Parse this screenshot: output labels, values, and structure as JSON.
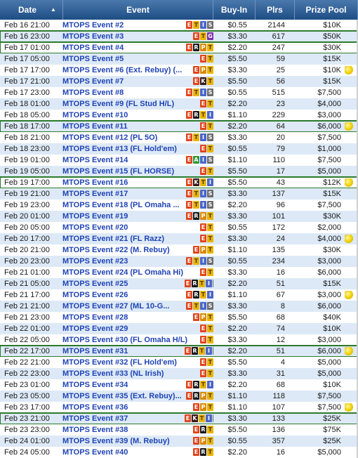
{
  "header": {
    "date_label": "Date",
    "sort_arrow": "▲",
    "event_label": "Event",
    "buyin_label": "Buy-In",
    "plrs_label": "Plrs",
    "prize_label": "Prize Pool"
  },
  "rows": [
    {
      "date": "Feb 16 21:00",
      "name": "MTOPS Event #2",
      "icons": [
        "E",
        "T",
        "I",
        "S"
      ],
      "buyin": "$0.55",
      "plrs": "2144",
      "prize": "$10K",
      "hl": false,
      "star": false
    },
    {
      "date": "Feb 16 23:00",
      "name": "MTOPS Event #3",
      "icons": [
        "E",
        "T",
        "G"
      ],
      "buyin": "$3.30",
      "plrs": "617",
      "prize": "$50K",
      "hl": true,
      "star": false
    },
    {
      "date": "Feb 17 01:00",
      "name": "MTOPS Event #4",
      "icons": [
        "E",
        "R",
        "P",
        "T"
      ],
      "buyin": "$2.20",
      "plrs": "247",
      "prize": "$30K",
      "hl": true,
      "star": false
    },
    {
      "date": "Feb 17 05:00",
      "name": "MTOPS Event #5",
      "icons": [
        "E",
        "T"
      ],
      "buyin": "$5.50",
      "plrs": "59",
      "prize": "$15K",
      "hl": false,
      "star": false
    },
    {
      "date": "Feb 17 17:00",
      "name": "MTOPS Event #6 (Ext. Rebuy) (...",
      "icons": [
        "E",
        "P",
        "T"
      ],
      "buyin": "$3.30",
      "plrs": "25",
      "prize": "$10K",
      "hl": false,
      "star": true
    },
    {
      "date": "Feb 17 21:00",
      "name": "MTOPS Event #7",
      "icons": [
        "E",
        "K",
        "T"
      ],
      "buyin": "$5.50",
      "plrs": "56",
      "prize": "$15K",
      "hl": false,
      "star": false
    },
    {
      "date": "Feb 17 23:00",
      "name": "MTOPS Event #8",
      "icons": [
        "E",
        "T",
        "I",
        "S"
      ],
      "buyin": "$0.55",
      "plrs": "515",
      "prize": "$7,500",
      "hl": false,
      "star": false
    },
    {
      "date": "Feb 18 01:00",
      "name": "MTOPS Event #9 (FL Stud H/L)",
      "icons": [
        "E",
        "T"
      ],
      "buyin": "$2.20",
      "plrs": "23",
      "prize": "$4,000",
      "hl": false,
      "star": false
    },
    {
      "date": "Feb 18 05:00",
      "name": "MTOPS Event #10",
      "icons": [
        "E",
        "R",
        "T",
        "I"
      ],
      "buyin": "$1.10",
      "plrs": "229",
      "prize": "$3,000",
      "hl": false,
      "star": false
    },
    {
      "date": "Feb 18 17:00",
      "name": "MTOPS Event #11",
      "icons": [
        "E",
        "T"
      ],
      "buyin": "$2.20",
      "plrs": "64",
      "prize": "$6,000",
      "hl": true,
      "star": true
    },
    {
      "date": "Feb 18 21:00",
      "name": "MTOPS Event #12 (PL 5O)",
      "icons": [
        "E",
        "T",
        "I",
        "S"
      ],
      "buyin": "$3.30",
      "plrs": "20",
      "prize": "$7,500",
      "hl": false,
      "star": false
    },
    {
      "date": "Feb 18 23:00",
      "name": "MTOPS Event #13 (FL Hold'em)",
      "icons": [
        "E",
        "T"
      ],
      "buyin": "$0.55",
      "plrs": "79",
      "prize": "$1,000",
      "hl": false,
      "star": false
    },
    {
      "date": "Feb 19 01:00",
      "name": "MTOPS Event #14",
      "icons": [
        "E",
        "A",
        "I",
        "S"
      ],
      "buyin": "$1.10",
      "plrs": "110",
      "prize": "$7,500",
      "hl": false,
      "star": false
    },
    {
      "date": "Feb 19 05:00",
      "name": "MTOPS Event #15 (FL HORSE)",
      "icons": [
        "E",
        "T"
      ],
      "buyin": "$5.50",
      "plrs": "17",
      "prize": "$5,000",
      "hl": false,
      "star": false
    },
    {
      "date": "Feb 19 17:00",
      "name": "MTOPS Event #16",
      "icons": [
        "E",
        "K",
        "T",
        "I"
      ],
      "buyin": "$5.50",
      "plrs": "43",
      "prize": "$12K",
      "hl": true,
      "star": true
    },
    {
      "date": "Feb 19 21:00",
      "name": "MTOPS Event #17",
      "icons": [
        "E",
        "T",
        "I",
        "S"
      ],
      "buyin": "$3.30",
      "plrs": "137",
      "prize": "$15K",
      "hl": false,
      "star": false
    },
    {
      "date": "Feb 19 23:00",
      "name": "MTOPS Event #18 (PL Omaha ...",
      "icons": [
        "E",
        "T",
        "I",
        "S"
      ],
      "buyin": "$2.20",
      "plrs": "96",
      "prize": "$7,500",
      "hl": false,
      "star": false
    },
    {
      "date": "Feb 20 01:00",
      "name": "MTOPS Event #19",
      "icons": [
        "E",
        "R",
        "P",
        "T"
      ],
      "buyin": "$3.30",
      "plrs": "101",
      "prize": "$30K",
      "hl": false,
      "star": false
    },
    {
      "date": "Feb 20 05:00",
      "name": "MTOPS Event #20",
      "icons": [
        "E",
        "T"
      ],
      "buyin": "$0.55",
      "plrs": "172",
      "prize": "$2,000",
      "hl": false,
      "star": false
    },
    {
      "date": "Feb 20 17:00",
      "name": "MTOPS Event #21 (FL Razz)",
      "icons": [
        "E",
        "T"
      ],
      "buyin": "$3.30",
      "plrs": "24",
      "prize": "$4,000",
      "hl": false,
      "star": true
    },
    {
      "date": "Feb 20 21:00",
      "name": "MTOPS Event #22 (M. Rebuy)",
      "icons": [
        "E",
        "P",
        "T"
      ],
      "buyin": "$1.10",
      "plrs": "135",
      "prize": "$30K",
      "hl": false,
      "star": false
    },
    {
      "date": "Feb 20 23:00",
      "name": "MTOPS Event #23",
      "icons": [
        "E",
        "T",
        "I",
        "S"
      ],
      "buyin": "$0.55",
      "plrs": "234",
      "prize": "$3,000",
      "hl": false,
      "star": false
    },
    {
      "date": "Feb 21 01:00",
      "name": "MTOPS Event #24 (PL Omaha Hi)",
      "icons": [
        "E",
        "T"
      ],
      "buyin": "$3.30",
      "plrs": "16",
      "prize": "$6,000",
      "hl": false,
      "star": false
    },
    {
      "date": "Feb 21 05:00",
      "name": "MTOPS Event #25",
      "icons": [
        "E",
        "R",
        "T",
        "I",
        "S"
      ],
      "buyin": "$2.20",
      "plrs": "51",
      "prize": "$15K",
      "hl": false,
      "star": false
    },
    {
      "date": "Feb 21 17:00",
      "name": "MTOPS Event #26",
      "icons": [
        "E",
        "R",
        "T",
        "I"
      ],
      "buyin": "$1.10",
      "plrs": "67",
      "prize": "$3,000",
      "hl": false,
      "star": true
    },
    {
      "date": "Feb 21 21:00",
      "name": "MTOPS Event #27 (ML 10-G...",
      "icons": [
        "E",
        "T",
        "I",
        "S"
      ],
      "buyin": "$3.30",
      "plrs": "8",
      "prize": "$6,000",
      "hl": false,
      "star": false
    },
    {
      "date": "Feb 21 23:00",
      "name": "MTOPS Event #28",
      "icons": [
        "E",
        "P",
        "T"
      ],
      "buyin": "$5.50",
      "plrs": "68",
      "prize": "$40K",
      "hl": false,
      "star": false
    },
    {
      "date": "Feb 22 01:00",
      "name": "MTOPS Event #29",
      "icons": [
        "E",
        "T"
      ],
      "buyin": "$2.20",
      "plrs": "74",
      "prize": "$10K",
      "hl": false,
      "star": false
    },
    {
      "date": "Feb 22 05:00",
      "name": "MTOPS Event #30 (FL Omaha H/L)",
      "icons": [
        "E",
        "T"
      ],
      "buyin": "$3.30",
      "plrs": "12",
      "prize": "$3,000",
      "hl": false,
      "star": false
    },
    {
      "date": "Feb 22 17:00",
      "name": "MTOPS Event #31",
      "icons": [
        "E",
        "R",
        "T",
        "I",
        "S"
      ],
      "buyin": "$2.20",
      "plrs": "51",
      "prize": "$6,000",
      "hl": true,
      "star": true
    },
    {
      "date": "Feb 22 21:00",
      "name": "MTOPS Event #32 (FL Hold'em)",
      "icons": [
        "E",
        "T"
      ],
      "buyin": "$5.50",
      "plrs": "4",
      "prize": "$5,000",
      "hl": false,
      "star": false
    },
    {
      "date": "Feb 22 23:00",
      "name": "MTOPS Event #33 (NL Irish)",
      "icons": [
        "E",
        "T"
      ],
      "buyin": "$3.30",
      "plrs": "31",
      "prize": "$5,000",
      "hl": false,
      "star": false
    },
    {
      "date": "Feb 23 01:00",
      "name": "MTOPS Event #34",
      "icons": [
        "E",
        "R",
        "T",
        "I"
      ],
      "buyin": "$2.20",
      "plrs": "68",
      "prize": "$10K",
      "hl": false,
      "star": false
    },
    {
      "date": "Feb 23 05:00",
      "name": "MTOPS Event #35 (Ext. Rebuy)...",
      "icons": [
        "E",
        "R",
        "P",
        "T"
      ],
      "buyin": "$1.10",
      "plrs": "118",
      "prize": "$7,500",
      "hl": false,
      "star": false
    },
    {
      "date": "Feb 23 17:00",
      "name": "MTOPS Event #36",
      "icons": [
        "E",
        "P",
        "T"
      ],
      "buyin": "$1.10",
      "plrs": "107",
      "prize": "$7,500",
      "hl": false,
      "star": true
    },
    {
      "date": "Feb 23 21:00",
      "name": "MTOPS Event #37",
      "icons": [
        "E",
        "K",
        "T",
        "I",
        "S"
      ],
      "buyin": "$3.30",
      "plrs": "133",
      "prize": "$25K",
      "hl": true,
      "star": false
    },
    {
      "date": "Feb 23 23:00",
      "name": "MTOPS Event #38",
      "icons": [
        "E",
        "R",
        "T"
      ],
      "buyin": "$5.50",
      "plrs": "136",
      "prize": "$75K",
      "hl": false,
      "star": false
    },
    {
      "date": "Feb 24 01:00",
      "name": "MTOPS Event #39 (M. Rebuy)",
      "icons": [
        "E",
        "P",
        "T"
      ],
      "buyin": "$0.55",
      "plrs": "357",
      "prize": "$25K",
      "hl": false,
      "star": false
    },
    {
      "date": "Feb 24 05:00",
      "name": "MTOPS Event #40",
      "icons": [
        "E",
        "R",
        "T"
      ],
      "buyin": "$2.20",
      "plrs": "16",
      "prize": "$5,000",
      "hl": false,
      "star": false
    }
  ]
}
